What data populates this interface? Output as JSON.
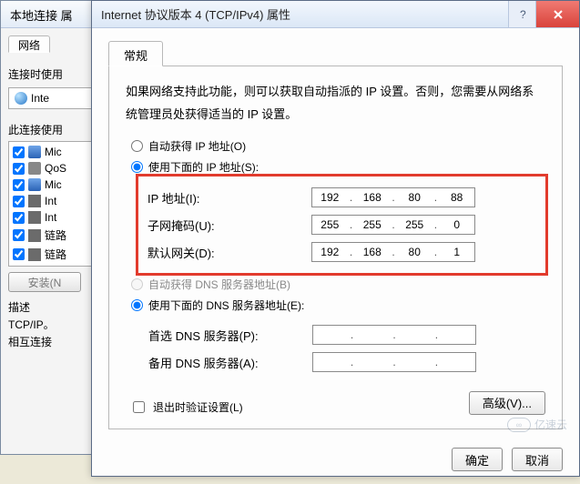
{
  "back_window": {
    "title": "本地连接 属",
    "network_tab": "网络",
    "connect_label": "连接时使用",
    "adapter_name": "Inte",
    "uses_label": "此连接使用",
    "items": [
      {
        "label": "Mic",
        "icon": "net"
      },
      {
        "label": "QoS",
        "icon": "qos"
      },
      {
        "label": "Mic",
        "icon": "net"
      },
      {
        "label": "Int",
        "icon": "link"
      },
      {
        "label": "Int",
        "icon": "link"
      },
      {
        "label": "链路",
        "icon": "link"
      },
      {
        "label": "链路",
        "icon": "link"
      }
    ],
    "install_btn": "安装(N",
    "desc_heading": "描述",
    "desc_line1": "TCP/IP。",
    "desc_line2": "相互连接"
  },
  "front_window": {
    "title": "Internet 协议版本 4 (TCP/IPv4) 属性",
    "tab_general": "常规",
    "info_text": "如果网络支持此功能，则可以获取自动指派的 IP 设置。否则，您需要从网络系统管理员处获得适当的 IP 设置。",
    "radio_auto_ip": "自动获得 IP 地址(O)",
    "radio_manual_ip": "使用下面的 IP 地址(S):",
    "ip_label": "IP 地址(I):",
    "subnet_label": "子网掩码(U):",
    "gateway_label": "默认网关(D):",
    "ip_value": [
      "192",
      "168",
      "80",
      "88"
    ],
    "subnet_value": [
      "255",
      "255",
      "255",
      "0"
    ],
    "gateway_value": [
      "192",
      "168",
      "80",
      "1"
    ],
    "radio_auto_dns": "自动获得 DNS 服务器地址(B)",
    "radio_manual_dns": "使用下面的 DNS 服务器地址(E):",
    "dns1_label": "首选 DNS 服务器(P):",
    "dns2_label": "备用 DNS 服务器(A):",
    "dns1_value": [
      "",
      "",
      "",
      ""
    ],
    "dns2_value": [
      "",
      "",
      "",
      ""
    ],
    "validate_label": "退出时验证设置(L)",
    "advanced_btn": "高级(V)...",
    "ok_btn": "确定",
    "cancel_btn": "取消"
  },
  "watermark": "亿速云"
}
